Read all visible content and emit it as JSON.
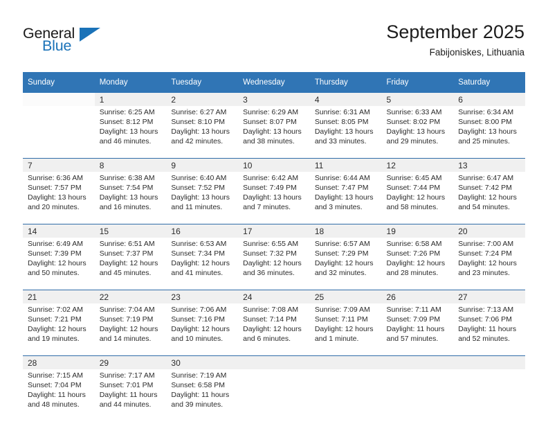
{
  "brand": {
    "word_top": "General",
    "word_bottom": "Blue",
    "accent_color": "#1a72b8",
    "triangle_icon": "triangle-icon"
  },
  "header": {
    "month_title": "September 2025",
    "location": "Fabijoniskes, Lithuania"
  },
  "calendar": {
    "header_bg": "#3075b5",
    "daynum_bg": "#f0f0f0",
    "week_rule_color": "#2f6ca8",
    "weekday_headers": [
      "Sunday",
      "Monday",
      "Tuesday",
      "Wednesday",
      "Thursday",
      "Friday",
      "Saturday"
    ],
    "weeks": [
      [
        {
          "day": "",
          "sunrise": "",
          "sunset": "",
          "daylight_1": "",
          "daylight_2": ""
        },
        {
          "day": "1",
          "sunrise": "Sunrise: 6:25 AM",
          "sunset": "Sunset: 8:12 PM",
          "daylight_1": "Daylight: 13 hours",
          "daylight_2": "and 46 minutes."
        },
        {
          "day": "2",
          "sunrise": "Sunrise: 6:27 AM",
          "sunset": "Sunset: 8:10 PM",
          "daylight_1": "Daylight: 13 hours",
          "daylight_2": "and 42 minutes."
        },
        {
          "day": "3",
          "sunrise": "Sunrise: 6:29 AM",
          "sunset": "Sunset: 8:07 PM",
          "daylight_1": "Daylight: 13 hours",
          "daylight_2": "and 38 minutes."
        },
        {
          "day": "4",
          "sunrise": "Sunrise: 6:31 AM",
          "sunset": "Sunset: 8:05 PM",
          "daylight_1": "Daylight: 13 hours",
          "daylight_2": "and 33 minutes."
        },
        {
          "day": "5",
          "sunrise": "Sunrise: 6:33 AM",
          "sunset": "Sunset: 8:02 PM",
          "daylight_1": "Daylight: 13 hours",
          "daylight_2": "and 29 minutes."
        },
        {
          "day": "6",
          "sunrise": "Sunrise: 6:34 AM",
          "sunset": "Sunset: 8:00 PM",
          "daylight_1": "Daylight: 13 hours",
          "daylight_2": "and 25 minutes."
        }
      ],
      [
        {
          "day": "7",
          "sunrise": "Sunrise: 6:36 AM",
          "sunset": "Sunset: 7:57 PM",
          "daylight_1": "Daylight: 13 hours",
          "daylight_2": "and 20 minutes."
        },
        {
          "day": "8",
          "sunrise": "Sunrise: 6:38 AM",
          "sunset": "Sunset: 7:54 PM",
          "daylight_1": "Daylight: 13 hours",
          "daylight_2": "and 16 minutes."
        },
        {
          "day": "9",
          "sunrise": "Sunrise: 6:40 AM",
          "sunset": "Sunset: 7:52 PM",
          "daylight_1": "Daylight: 13 hours",
          "daylight_2": "and 11 minutes."
        },
        {
          "day": "10",
          "sunrise": "Sunrise: 6:42 AM",
          "sunset": "Sunset: 7:49 PM",
          "daylight_1": "Daylight: 13 hours",
          "daylight_2": "and 7 minutes."
        },
        {
          "day": "11",
          "sunrise": "Sunrise: 6:44 AM",
          "sunset": "Sunset: 7:47 PM",
          "daylight_1": "Daylight: 13 hours",
          "daylight_2": "and 3 minutes."
        },
        {
          "day": "12",
          "sunrise": "Sunrise: 6:45 AM",
          "sunset": "Sunset: 7:44 PM",
          "daylight_1": "Daylight: 12 hours",
          "daylight_2": "and 58 minutes."
        },
        {
          "day": "13",
          "sunrise": "Sunrise: 6:47 AM",
          "sunset": "Sunset: 7:42 PM",
          "daylight_1": "Daylight: 12 hours",
          "daylight_2": "and 54 minutes."
        }
      ],
      [
        {
          "day": "14",
          "sunrise": "Sunrise: 6:49 AM",
          "sunset": "Sunset: 7:39 PM",
          "daylight_1": "Daylight: 12 hours",
          "daylight_2": "and 50 minutes."
        },
        {
          "day": "15",
          "sunrise": "Sunrise: 6:51 AM",
          "sunset": "Sunset: 7:37 PM",
          "daylight_1": "Daylight: 12 hours",
          "daylight_2": "and 45 minutes."
        },
        {
          "day": "16",
          "sunrise": "Sunrise: 6:53 AM",
          "sunset": "Sunset: 7:34 PM",
          "daylight_1": "Daylight: 12 hours",
          "daylight_2": "and 41 minutes."
        },
        {
          "day": "17",
          "sunrise": "Sunrise: 6:55 AM",
          "sunset": "Sunset: 7:32 PM",
          "daylight_1": "Daylight: 12 hours",
          "daylight_2": "and 36 minutes."
        },
        {
          "day": "18",
          "sunrise": "Sunrise: 6:57 AM",
          "sunset": "Sunset: 7:29 PM",
          "daylight_1": "Daylight: 12 hours",
          "daylight_2": "and 32 minutes."
        },
        {
          "day": "19",
          "sunrise": "Sunrise: 6:58 AM",
          "sunset": "Sunset: 7:26 PM",
          "daylight_1": "Daylight: 12 hours",
          "daylight_2": "and 28 minutes."
        },
        {
          "day": "20",
          "sunrise": "Sunrise: 7:00 AM",
          "sunset": "Sunset: 7:24 PM",
          "daylight_1": "Daylight: 12 hours",
          "daylight_2": "and 23 minutes."
        }
      ],
      [
        {
          "day": "21",
          "sunrise": "Sunrise: 7:02 AM",
          "sunset": "Sunset: 7:21 PM",
          "daylight_1": "Daylight: 12 hours",
          "daylight_2": "and 19 minutes."
        },
        {
          "day": "22",
          "sunrise": "Sunrise: 7:04 AM",
          "sunset": "Sunset: 7:19 PM",
          "daylight_1": "Daylight: 12 hours",
          "daylight_2": "and 14 minutes."
        },
        {
          "day": "23",
          "sunrise": "Sunrise: 7:06 AM",
          "sunset": "Sunset: 7:16 PM",
          "daylight_1": "Daylight: 12 hours",
          "daylight_2": "and 10 minutes."
        },
        {
          "day": "24",
          "sunrise": "Sunrise: 7:08 AM",
          "sunset": "Sunset: 7:14 PM",
          "daylight_1": "Daylight: 12 hours",
          "daylight_2": "and 6 minutes."
        },
        {
          "day": "25",
          "sunrise": "Sunrise: 7:09 AM",
          "sunset": "Sunset: 7:11 PM",
          "daylight_1": "Daylight: 12 hours",
          "daylight_2": "and 1 minute."
        },
        {
          "day": "26",
          "sunrise": "Sunrise: 7:11 AM",
          "sunset": "Sunset: 7:09 PM",
          "daylight_1": "Daylight: 11 hours",
          "daylight_2": "and 57 minutes."
        },
        {
          "day": "27",
          "sunrise": "Sunrise: 7:13 AM",
          "sunset": "Sunset: 7:06 PM",
          "daylight_1": "Daylight: 11 hours",
          "daylight_2": "and 52 minutes."
        }
      ],
      [
        {
          "day": "28",
          "sunrise": "Sunrise: 7:15 AM",
          "sunset": "Sunset: 7:04 PM",
          "daylight_1": "Daylight: 11 hours",
          "daylight_2": "and 48 minutes."
        },
        {
          "day": "29",
          "sunrise": "Sunrise: 7:17 AM",
          "sunset": "Sunset: 7:01 PM",
          "daylight_1": "Daylight: 11 hours",
          "daylight_2": "and 44 minutes."
        },
        {
          "day": "30",
          "sunrise": "Sunrise: 7:19 AM",
          "sunset": "Sunset: 6:58 PM",
          "daylight_1": "Daylight: 11 hours",
          "daylight_2": "and 39 minutes."
        },
        {
          "day": "",
          "sunrise": "",
          "sunset": "",
          "daylight_1": "",
          "daylight_2": ""
        },
        {
          "day": "",
          "sunrise": "",
          "sunset": "",
          "daylight_1": "",
          "daylight_2": ""
        },
        {
          "day": "",
          "sunrise": "",
          "sunset": "",
          "daylight_1": "",
          "daylight_2": ""
        },
        {
          "day": "",
          "sunrise": "",
          "sunset": "",
          "daylight_1": "",
          "daylight_2": ""
        }
      ]
    ]
  }
}
